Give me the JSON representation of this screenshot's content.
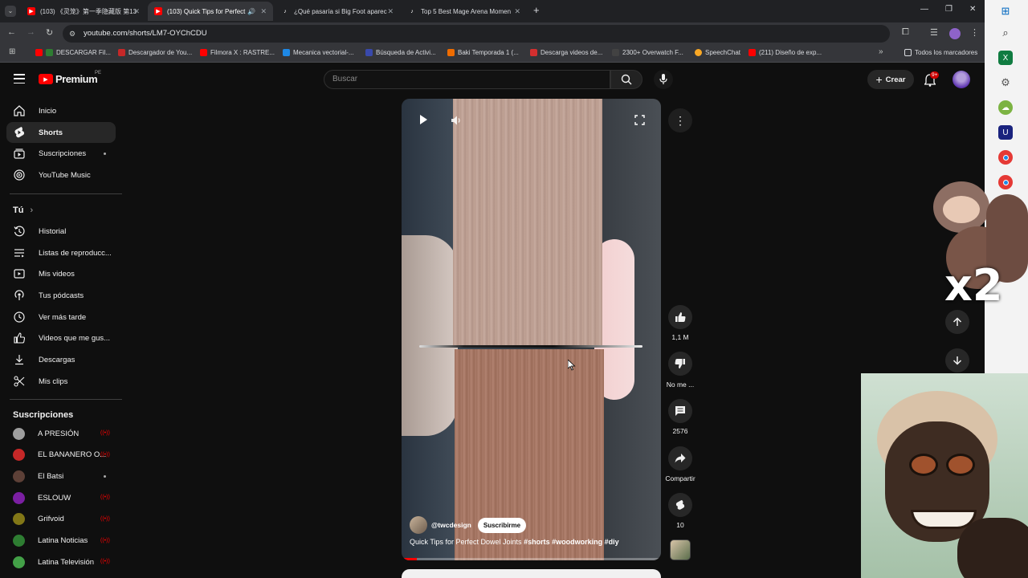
{
  "browser": {
    "tabs": [
      {
        "title": "(103) 《灵笼》第一季隐藏版 第13",
        "active": false
      },
      {
        "title": "(103) Quick Tips for Perfect",
        "active": true
      },
      {
        "title": "¿Qué pasaría si Big Foot aparec",
        "active": false
      },
      {
        "title": "Top 5 Best Mage Arena Momen",
        "active": false
      }
    ],
    "url": "youtube.com/shorts/LM7-OYChCDU",
    "bookmarks": [
      "DESCARGAR Fil...",
      "Descargador de You...",
      "Filmora X : RASTRE...",
      "Mecanica vectorial-...",
      "Búsqueda de Activi...",
      "Baki Temporada 1 (...",
      "Descarga videos de...",
      "2300+ Overwatch F...",
      "SpeechChat",
      "(211) Diseño de exp..."
    ],
    "all_bookmarks": "Todos los marcadores"
  },
  "youtube": {
    "logo": "Premium",
    "region": "PE",
    "search_placeholder": "Buscar",
    "create_label": "Crear",
    "notif_badge": "9+",
    "nav_main": [
      {
        "label": "Inicio",
        "icon": "home-icon"
      },
      {
        "label": "Shorts",
        "icon": "shorts-icon"
      },
      {
        "label": "Suscripciones",
        "icon": "subscriptions-icon"
      },
      {
        "label": "YouTube Music",
        "icon": "music-icon"
      }
    ],
    "you_section": "Tú",
    "nav_you": [
      {
        "label": "Historial",
        "icon": "history-icon"
      },
      {
        "label": "Listas de reproducc...",
        "icon": "playlist-icon"
      },
      {
        "label": "Mis videos",
        "icon": "video-icon"
      },
      {
        "label": "Tus pódcasts",
        "icon": "podcast-icon"
      },
      {
        "label": "Ver más tarde",
        "icon": "clock-icon"
      },
      {
        "label": "Videos que me gus...",
        "icon": "like-icon"
      },
      {
        "label": "Descargas",
        "icon": "download-icon"
      },
      {
        "label": "Mis clips",
        "icon": "scissors-icon"
      }
    ],
    "subs_title": "Suscripciones",
    "subscriptions": [
      {
        "name": "A PRESIÓN",
        "color": "#9e9e9e",
        "status": "live"
      },
      {
        "name": "EL BANANERO O...",
        "color": "#c62828",
        "status": "live"
      },
      {
        "name": "El Batsi",
        "color": "#5d4037",
        "status": "dot"
      },
      {
        "name": "ESLOUW",
        "color": "#7b1fa2",
        "status": "live"
      },
      {
        "name": "Grifvoid",
        "color": "#827717",
        "status": "live"
      },
      {
        "name": "Latina Noticias",
        "color": "#2e7d32",
        "status": "live"
      },
      {
        "name": "Latina Televisión",
        "color": "#43a047",
        "status": "live"
      }
    ],
    "short": {
      "channel": "@twcdesign",
      "subscribe": "Suscribirme",
      "title": "Quick Tips for Perfect Dowel Joints ",
      "hashtags": "#shorts #woodworking #diy",
      "likes": "1,1 M",
      "dislike_label": "No me ...",
      "comments": "2576",
      "share_label": "Compartir",
      "remix_count": "10",
      "progress": 0.06
    },
    "overlay_text": "x2"
  }
}
